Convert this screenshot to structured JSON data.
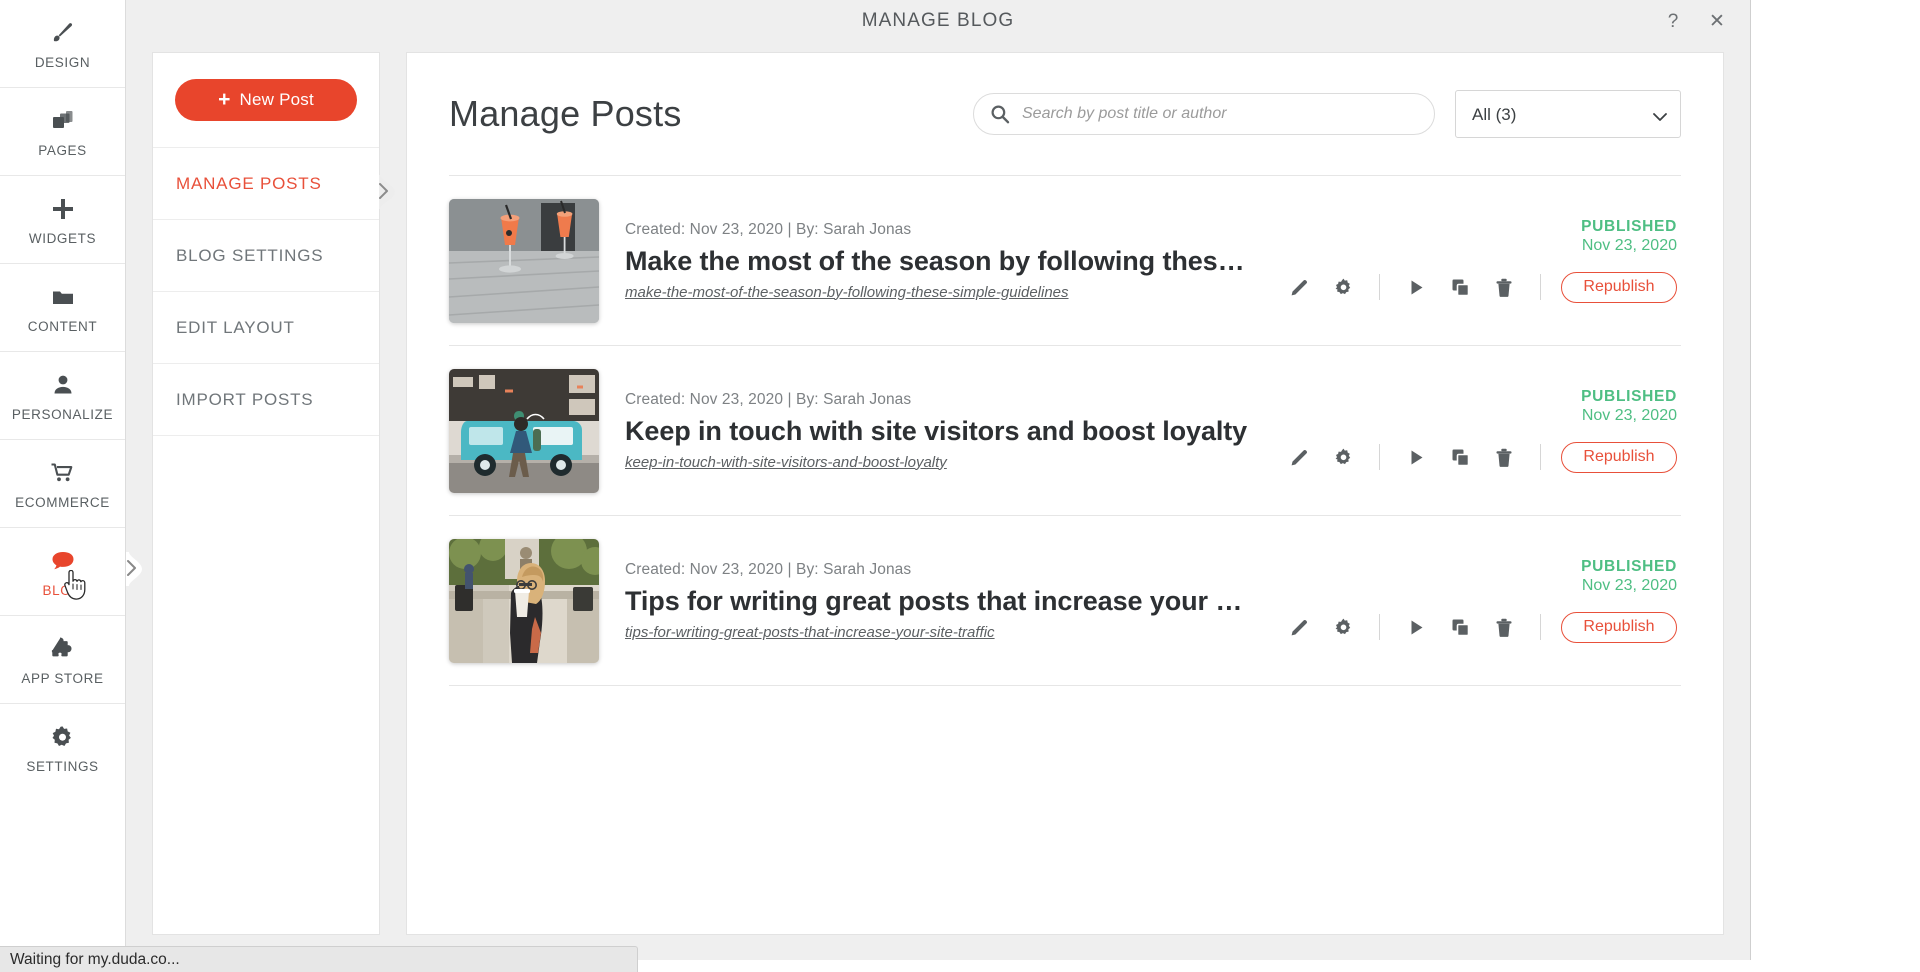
{
  "rail": {
    "items": [
      {
        "label": "DESIGN",
        "icon": "brush-icon",
        "active": false
      },
      {
        "label": "PAGES",
        "icon": "pages-icon",
        "active": false
      },
      {
        "label": "WIDGETS",
        "icon": "plus-icon",
        "active": false
      },
      {
        "label": "CONTENT",
        "icon": "folder-icon",
        "active": false
      },
      {
        "label": "PERSONALIZE",
        "icon": "person-icon",
        "active": false
      },
      {
        "label": "ECOMMERCE",
        "icon": "cart-icon",
        "active": false
      },
      {
        "label": "BLOG",
        "icon": "speech-bubble-icon",
        "active": true
      },
      {
        "label": "APP STORE",
        "icon": "puzzle-icon",
        "active": false
      },
      {
        "label": "SETTINGS",
        "icon": "gear-icon",
        "active": false
      }
    ]
  },
  "dialog": {
    "title": "MANAGE BLOG",
    "help_label": "?",
    "close_label": "✕"
  },
  "blog_menu": {
    "new_post_label": "New Post",
    "new_post_plus": "+",
    "items": [
      {
        "label": "MANAGE POSTS",
        "active": true
      },
      {
        "label": "BLOG SETTINGS",
        "active": false
      },
      {
        "label": "EDIT LAYOUT",
        "active": false
      },
      {
        "label": "IMPORT POSTS",
        "active": false
      }
    ]
  },
  "main": {
    "heading": "Manage Posts",
    "search": {
      "placeholder": "Search by post title or author",
      "value": ""
    },
    "filter": {
      "selected": "All (3)",
      "options": [
        "All (3)"
      ]
    }
  },
  "posts": [
    {
      "meta": "Created: Nov 23, 2020 | By: Sarah Jonas",
      "title": "Make the most of the season by following these simple gu…",
      "slug": "make-the-most-of-the-season-by-following-these-simple-guidelines",
      "status": "PUBLISHED",
      "status_date": "Nov 23, 2020",
      "status_color": "#4ebe83",
      "republish_label": "Republish",
      "thumb": "cocktail-glasses-on-wooden-table"
    },
    {
      "meta": "Created: Nov 23, 2020 | By: Sarah Jonas",
      "title": "Keep in touch with site visitors and boost loyalty",
      "slug": "keep-in-touch-with-site-visitors-and-boost-loyalty",
      "status": "PUBLISHED",
      "status_date": "Nov 23, 2020",
      "status_color": "#4ebe83",
      "republish_label": "Republish",
      "thumb": "teal-food-van-with-man-walking"
    },
    {
      "meta": "Created: Nov 23, 2020 | By: Sarah Jonas",
      "title": "Tips for writing great posts that increase your site traffic",
      "slug": "tips-for-writing-great-posts-that-increase-your-site-traffic",
      "status": "PUBLISHED",
      "status_date": "Nov 23, 2020",
      "status_color": "#4ebe83",
      "republish_label": "Republish",
      "thumb": "woman-drinking-coffee-outdoors"
    }
  ],
  "row_actions": [
    {
      "name": "edit-post",
      "icon": "pencil-icon"
    },
    {
      "name": "post-settings",
      "icon": "gear-icon"
    },
    {
      "name": "preview-post",
      "icon": "play-icon"
    },
    {
      "name": "duplicate-post",
      "icon": "copy-icon"
    },
    {
      "name": "delete-post",
      "icon": "trash-icon"
    }
  ],
  "statusbar": {
    "text": "Waiting for my.duda.co..."
  },
  "colors": {
    "brand_red": "#e8452c",
    "accent_red": "#e8503a",
    "status_green": "#4ebe83",
    "dialog_bg": "#efefef",
    "text_primary": "#3c4043",
    "text_muted": "#7d8184"
  }
}
